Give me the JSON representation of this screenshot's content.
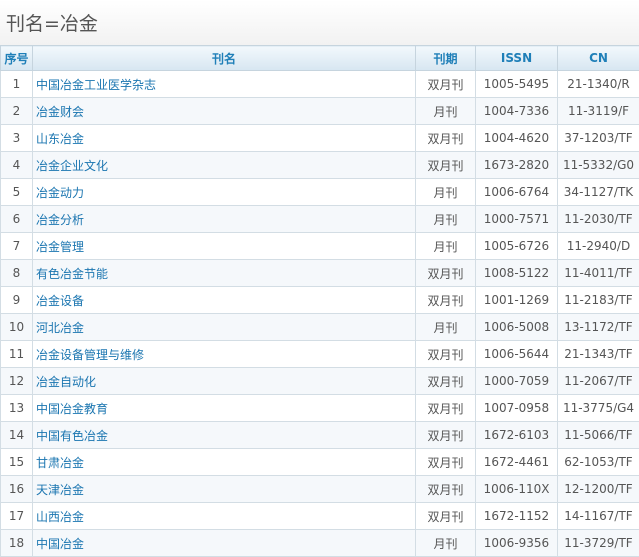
{
  "page_title": "刊名=冶金",
  "table": {
    "headers": {
      "num": "序号",
      "name": "刊名",
      "period": "刊期",
      "issn": "ISSN",
      "cn": "CN"
    },
    "rows": [
      {
        "num": "1",
        "name": "中国冶金工业医学杂志",
        "period": "双月刊",
        "issn": "1005-5495",
        "cn": "21-1340/R"
      },
      {
        "num": "2",
        "name": "冶金财会",
        "period": "月刊",
        "issn": "1004-7336",
        "cn": "11-3119/F"
      },
      {
        "num": "3",
        "name": "山东冶金",
        "period": "双月刊",
        "issn": "1004-4620",
        "cn": "37-1203/TF"
      },
      {
        "num": "4",
        "name": "冶金企业文化",
        "period": "双月刊",
        "issn": "1673-2820",
        "cn": "11-5332/G0"
      },
      {
        "num": "5",
        "name": "冶金动力",
        "period": "月刊",
        "issn": "1006-6764",
        "cn": "34-1127/TK"
      },
      {
        "num": "6",
        "name": "冶金分析",
        "period": "月刊",
        "issn": "1000-7571",
        "cn": "11-2030/TF"
      },
      {
        "num": "7",
        "name": "冶金管理",
        "period": "月刊",
        "issn": "1005-6726",
        "cn": "11-2940/D"
      },
      {
        "num": "8",
        "name": "有色冶金节能",
        "period": "双月刊",
        "issn": "1008-5122",
        "cn": "11-4011/TF"
      },
      {
        "num": "9",
        "name": "冶金设备",
        "period": "双月刊",
        "issn": "1001-1269",
        "cn": "11-2183/TF"
      },
      {
        "num": "10",
        "name": "河北冶金",
        "period": "月刊",
        "issn": "1006-5008",
        "cn": "13-1172/TF"
      },
      {
        "num": "11",
        "name": "冶金设备管理与维修",
        "period": "双月刊",
        "issn": "1006-5644",
        "cn": "21-1343/TF"
      },
      {
        "num": "12",
        "name": "冶金自动化",
        "period": "双月刊",
        "issn": "1000-7059",
        "cn": "11-2067/TF"
      },
      {
        "num": "13",
        "name": "中国冶金教育",
        "period": "双月刊",
        "issn": "1007-0958",
        "cn": "11-3775/G4"
      },
      {
        "num": "14",
        "name": "中国有色冶金",
        "period": "双月刊",
        "issn": "1672-6103",
        "cn": "11-5066/TF"
      },
      {
        "num": "15",
        "name": "甘肃冶金",
        "period": "双月刊",
        "issn": "1672-4461",
        "cn": "62-1053/TF"
      },
      {
        "num": "16",
        "name": "天津冶金",
        "period": "双月刊",
        "issn": "1006-110X",
        "cn": "12-1200/TF"
      },
      {
        "num": "17",
        "name": "山西冶金",
        "period": "双月刊",
        "issn": "1672-1152",
        "cn": "14-1167/TF"
      },
      {
        "num": "18",
        "name": "中国冶金",
        "period": "月刊",
        "issn": "1006-9356",
        "cn": "11-3729/TF"
      }
    ]
  }
}
